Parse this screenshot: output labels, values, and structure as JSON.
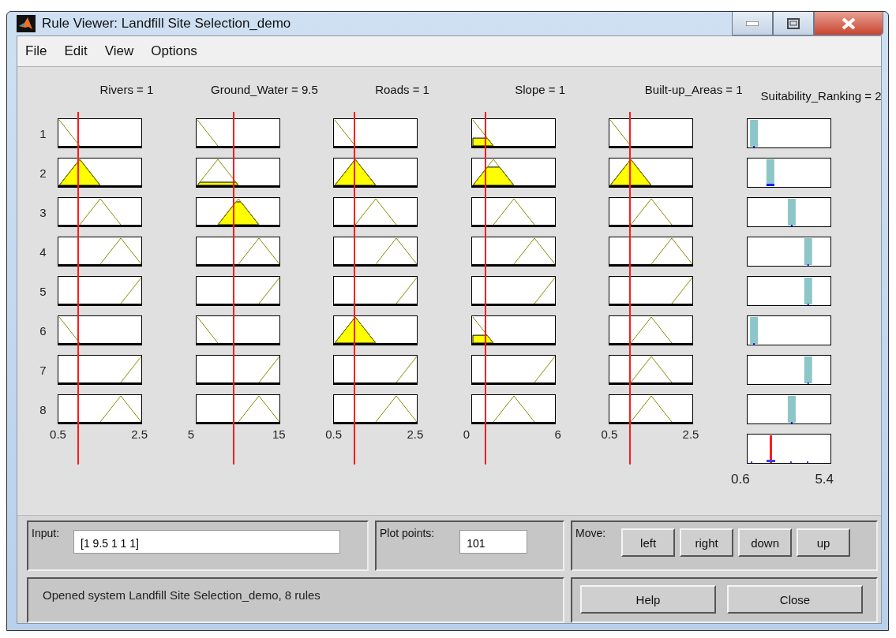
{
  "window": {
    "title": "Rule Viewer: Landfill Site Selection_demo"
  },
  "menu": [
    "File",
    "Edit",
    "View",
    "Options"
  ],
  "rules": [
    "1",
    "2",
    "3",
    "4",
    "5",
    "6",
    "7",
    "8"
  ],
  "inputs": [
    {
      "header": "Rivers = 1",
      "ticks": [
        "0.5",
        "2.5"
      ],
      "cells": [
        {
          "kind": "falling"
        },
        {
          "kind": "peak-low",
          "fill": {
            "kind": "full"
          }
        },
        {
          "kind": "peak-mid"
        },
        {
          "kind": "peak-high"
        },
        {
          "kind": "rising"
        },
        {
          "kind": "falling"
        },
        {
          "kind": "rising"
        },
        {
          "kind": "peak-high"
        }
      ]
    },
    {
      "header": "Ground_Water = 9.5",
      "ticks": [
        "5",
        "15"
      ],
      "cells": [
        {
          "kind": "falling"
        },
        {
          "kind": "peak-low",
          "fill": {
            "kind": "thin"
          }
        },
        {
          "kind": "peak-mid",
          "fill": {
            "kind": "high"
          }
        },
        {
          "kind": "peak-high"
        },
        {
          "kind": "rising"
        },
        {
          "kind": "falling"
        },
        {
          "kind": "rising"
        },
        {
          "kind": "peak-high"
        }
      ]
    },
    {
      "header": "Roads = 1",
      "ticks": [
        "0.5",
        "2.5"
      ],
      "cells": [
        {
          "kind": "falling"
        },
        {
          "kind": "peak-low",
          "fill": {
            "kind": "full"
          }
        },
        {
          "kind": "peak-mid"
        },
        {
          "kind": "peak-high"
        },
        {
          "kind": "rising"
        },
        {
          "kind": "peak-low",
          "fill": {
            "kind": "full"
          }
        },
        {
          "kind": "rising"
        },
        {
          "kind": "peak-high"
        }
      ]
    },
    {
      "header": "Slope = 1",
      "ticks": [
        "0",
        "6"
      ],
      "cells": [
        {
          "kind": "falling",
          "fill": {
            "kind": "low"
          }
        },
        {
          "kind": "peak-low",
          "fill": {
            "kind": "mid"
          }
        },
        {
          "kind": "peak-mid"
        },
        {
          "kind": "peak-high"
        },
        {
          "kind": "rising"
        },
        {
          "kind": "falling",
          "fill": {
            "kind": "low"
          }
        },
        {
          "kind": "rising"
        },
        {
          "kind": "peak-mid"
        }
      ]
    },
    {
      "header": "Built-up_Areas = 1",
      "ticks": [
        "0.5",
        "2.5"
      ],
      "cells": [
        {
          "kind": "falling"
        },
        {
          "kind": "peak-low",
          "fill": {
            "kind": "full"
          }
        },
        {
          "kind": "peak-mid"
        },
        {
          "kind": "peak-high"
        },
        {
          "kind": "rising"
        },
        {
          "kind": "peak-mid"
        },
        {
          "kind": "peak-mid"
        },
        {
          "kind": "peak-mid"
        }
      ]
    }
  ],
  "output": {
    "header": "Suitability_Ranking = 2",
    "ticks": [
      "0.6",
      "5.4"
    ],
    "cells": [
      {
        "kind": "very-low",
        "fired": false
      },
      {
        "kind": "low",
        "fired": true
      },
      {
        "kind": "medium",
        "fired": false
      },
      {
        "kind": "high",
        "fired": false
      },
      {
        "kind": "high",
        "fired": false
      },
      {
        "kind": "very-low",
        "fired": false
      },
      {
        "kind": "high",
        "fired": false
      },
      {
        "kind": "medium",
        "fired": false
      }
    ]
  },
  "input": {
    "label": "Input:",
    "value": "[1 9.5 1 1 1]"
  },
  "plot_points": {
    "label": "Plot points:",
    "value": "101"
  },
  "move": {
    "label": "Move:",
    "buttons": [
      "left",
      "right",
      "down",
      "up"
    ]
  },
  "status": "Opened system Landfill Site Selection_demo, 8 rules",
  "buttons": [
    "Help",
    "Close"
  ]
}
